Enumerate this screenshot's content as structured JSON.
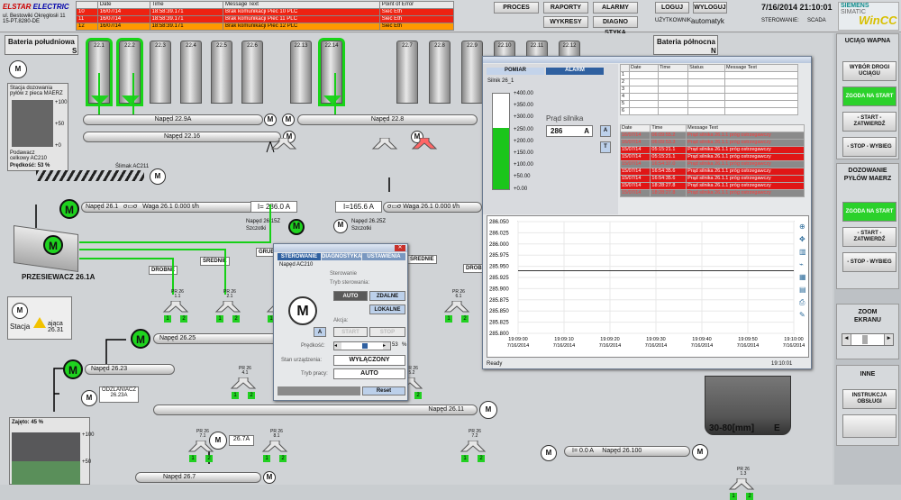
{
  "header": {
    "logo": {
      "brand1": "ELSTAR",
      "brand2": "ELECTRIC",
      "sub1": "ul. Bestowiki Okręgłosłi 11",
      "sub2": "15-PT.8280-DE"
    },
    "alarms": {
      "cols": [
        "",
        "Date",
        "Time",
        "Message Text",
        "Point of Error"
      ],
      "rows": [
        [
          "10",
          "16/07/14",
          "18:58:39.171",
          "Brak komunikacji Piec 10 PLC",
          "Sieć Eth"
        ],
        [
          "11",
          "16/07/14",
          "18:58:39.171",
          "Brak komunikacji Piec 11 PLC",
          "Sieć Eth"
        ],
        [
          "12",
          "16/07/14",
          "18:58:39.171",
          "Brak komunikacji Piec 12 PLC",
          "Sieć Eth"
        ]
      ]
    },
    "buttons": {
      "proces": "PROCES",
      "raporty": "RAPORTY",
      "alarmy": "ALARMY",
      "wykresy": "WYKRESY",
      "diagnostyka": "DIAGNO STYKA",
      "loguj": "LOGUJ",
      "wyloguj": "WYLOGUJ"
    },
    "user_label": "UŻYTKOWNIK:",
    "user": "automatyk",
    "datetime": "7/16/2014 21:10:01",
    "control_label": "STEROWANIE:",
    "control": "SCADA",
    "siemens": "SIEMENS",
    "simatic": "SIMATIC",
    "wincc": "WinCC"
  },
  "right_panel": {
    "s1_title": "UCIĄG WAPNA",
    "s1_b1": "WYBÓR DROGI UCIĄGU",
    "s1_b2": "ZGODA NA START",
    "s1_b3": "- START - ZATWIERDŹ",
    "s1_b4": "- STOP - WYBIEG",
    "s2_title": "DOZOWANIE PYŁÓW MAERZ",
    "s2_b1": "ZGODA NA START",
    "s2_b2": "- START - ZATWIERDŹ",
    "s2_b3": "- STOP - WYBIEG",
    "s3_title": "ZOOM EKRANU",
    "s4_title": "INNE",
    "s4_b1": "INSTRUKCJA OBSŁUGI"
  },
  "process": {
    "bateria_s": "Bateria południowa",
    "s_letter": "S",
    "bateria_n": "Bateria północna",
    "n_letter": "N",
    "silos_left": [
      "22.1",
      "22.2",
      "22.3",
      "22.4",
      "22.5",
      "22.6"
    ],
    "silos_mid": [
      "22.13",
      "22.14"
    ],
    "silos_right": [
      "22.7",
      "22.8",
      "22.9",
      "22.10",
      "22.11",
      "22.12"
    ],
    "naped229a": "Napęd 22.9A",
    "naped228": "Napęd 22.8",
    "naped2216": "Napęd 22.16",
    "stacja_dozow": "Stacja dozowania pyłów z pieca MAERZ",
    "podawacz": "Podawacz celkowy AC210",
    "predkosc": "Prędkość:",
    "predkosc_val": "53",
    "pct": "%",
    "slimak": "Ślimak AC211",
    "naped261": "Napęd 26.1",
    "waga261": "Waga 26.1",
    "waga261_val": "0.000 t/h",
    "i_val1": "I= 286.0 A",
    "i_val2": "I=165.6 A",
    "waga261b": "Waga 26.1",
    "waga261b_val": "0.000 t/h",
    "naped2615z": "Napęd 26.15Z",
    "szczotki1": "Szczotki",
    "naped2625z": "Napęd 26.25Z",
    "szczotki2": "Szczotki",
    "przesiewacz": "PRZESIEWACZ 26.1A",
    "drobne": "DROBNE",
    "srednie": "ŚREDNIE",
    "grube": "GRUBE",
    "srednie2": "ŚREDNIE",
    "drobne2": "DROBNE",
    "pr261": "PR 26 1.1",
    "pr262": "PR 26 2.1",
    "pr263": "PR 26 3.1",
    "pr264": "PR 26 4.1",
    "pr265": "PR 26 5.2",
    "pr266": "PR 26 6.1",
    "pr267": "PR 26 7.1",
    "pr268": "PR 26 8.1",
    "pr269": "PR 26 7.2",
    "pr2610": "PR 26 1.3",
    "stacja": "Stacja",
    "stacja_val": "ająca 26.31",
    "naped2625": "Napęd 26.25",
    "naped2623": "Napęd 26.23",
    "odzlaniacz": "ODZLANIACZ 26.23A",
    "naped2611": "Napęd 26.11",
    "naped267a": "26.7A",
    "naped267": "Napęd 26.7",
    "naped26100": "Napęd 26.100",
    "i_val3": "I= 0.0 A",
    "zajetosc": "Zajęto: 45 %",
    "size": "30-80[mm]",
    "e_letter": "E"
  },
  "trend_window": {
    "tab_pomiar": "POMIAR",
    "tab_alarm": "ALARM",
    "silnik": "Silnik  26_1",
    "scale": [
      "+400.00",
      "+350.00",
      "+300.00",
      "+250.00",
      "+200.00",
      "+150.00",
      "+100.00",
      "+50.00",
      "+0.00"
    ],
    "fill_fraction": 0.64,
    "prad_label": "Prąd silnika",
    "prad_val": "286",
    "prad_unit": "A",
    "btn_a": "A",
    "btn_t": "T",
    "small_cols": [
      "",
      "Date",
      "Time",
      "Status",
      "Message Text"
    ],
    "small_rows": [
      "1",
      "2",
      "3",
      "4",
      "5",
      "6"
    ],
    "alm_cols": [
      "Date",
      "Time",
      "Message Text"
    ],
    "alm_rows": [
      {
        "d": "16/07/14",
        "t": "06:09:55.2",
        "m": "Prąd silnika 26.1.1 próg ostrzegawczy",
        "c": "g"
      },
      {
        "d": "16/07/14",
        "t": "06:09:53.3",
        "m": "Prąd silnika 26.1.1 próg ostrzegawczy",
        "c": "g"
      },
      {
        "d": "15/07/14",
        "t": "05:15:21.1",
        "m": "Prąd silnika 26.1.1 próg ostrzegawczy",
        "c": "r"
      },
      {
        "d": "15/07/14",
        "t": "05:15:21.1",
        "m": "Prąd silnika 26.1.1 próg ostrzegawczy",
        "c": "r"
      },
      {
        "d": "15/07/14",
        "t": "16:54:37.0",
        "m": "Prąd silnika 26.1.1 próg ostrzegawczy",
        "c": "g"
      },
      {
        "d": "15/07/14",
        "t": "16:54:35.6",
        "m": "Prąd silnika 26.1.1 próg ostrzegawczy",
        "c": "r"
      },
      {
        "d": "15/07/14",
        "t": "16:54:35.6",
        "m": "Prąd silnika 26.1.1 próg ostrzegawczy",
        "c": "r"
      },
      {
        "d": "15/07/14",
        "t": "18:28:27.8",
        "m": "Prąd silnika 26.1.1 próg ostrzegawczy",
        "c": "r"
      },
      {
        "d": "15/07/14",
        "t": "18:28:27.8",
        "m": "Prąd silnika 26.1.1 próg ostrzegawczy",
        "c": "g"
      }
    ],
    "chart_yticks": [
      "286.050",
      "286.025",
      "286.000",
      "285.975",
      "285.950",
      "285.925",
      "285.900",
      "285.875",
      "285.850",
      "285.825",
      "285.800"
    ],
    "chart_xticks": [
      {
        "t": "19:09:00",
        "d": "7/16/2014"
      },
      {
        "t": "19:09:10",
        "d": "7/16/2014"
      },
      {
        "t": "19:09:20",
        "d": "7/16/2014"
      },
      {
        "t": "19:09:30",
        "d": "7/16/2014"
      },
      {
        "t": "19:09:40",
        "d": "7/16/2014"
      },
      {
        "t": "19:09:50",
        "d": "7/16/2014"
      },
      {
        "t": "19:10:00",
        "d": "7/16/2014"
      }
    ],
    "status": "Ready",
    "status_time": "19:10:01"
  },
  "dialog": {
    "tab1": "STEROWANIE",
    "tab2": "DIAGNOSTYKA",
    "tab3": "USTAWIENIA",
    "title": "Napęd AC210",
    "sterowanie": "Sterowanie",
    "tryb": "Tryb sterowania:",
    "auto": "AUTO",
    "zdalne": "ZDALNE",
    "lokalne": "LOKALNE",
    "akcja": "Akcja:",
    "btn_a": "A",
    "start": "START",
    "stop": "STOP",
    "predkosc": "Prędkość:",
    "predkosc_val": "53",
    "pct": "%",
    "stan": "Stan urządzenia:",
    "stan_val": "WYŁĄCZONY",
    "tryb_pracy": "Tryb pracy:",
    "tryb_val": "AUTO",
    "reset": "Reset"
  }
}
